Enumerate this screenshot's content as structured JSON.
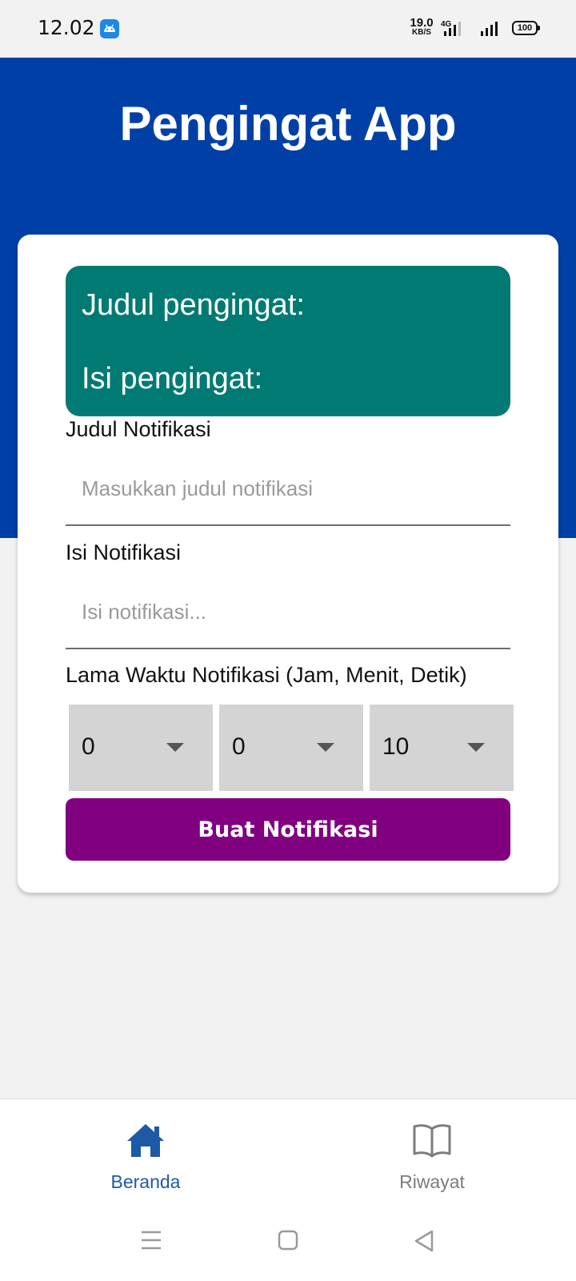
{
  "status_bar": {
    "time": "12.02",
    "net_speed_value": "19.0",
    "net_speed_unit": "KB/S",
    "network_type": "4G",
    "battery_level": "100",
    "icons": [
      "android-notification-icon",
      "signal-4g-icon",
      "signal-icon",
      "battery-icon"
    ]
  },
  "header": {
    "title": "Pengingat App",
    "background_color": "#0040a6"
  },
  "preview": {
    "title_label": "Judul pengingat:",
    "body_label": "Isi pengingat:",
    "background_color": "#007a72"
  },
  "form": {
    "title_field": {
      "label": "Judul Notifikasi",
      "placeholder": "Masukkan judul notifikasi",
      "value": ""
    },
    "body_field": {
      "label": "Isi Notifikasi",
      "placeholder": "Isi notifikasi...",
      "value": ""
    },
    "duration": {
      "label": "Lama Waktu Notifikasi (Jam, Menit, Detik)",
      "hours": "0",
      "minutes": "0",
      "seconds": "10"
    },
    "submit_label": "Buat Notifikasi",
    "submit_color": "#800080"
  },
  "bottom_nav": {
    "items": [
      {
        "label": "Beranda",
        "icon": "home-icon",
        "active": true
      },
      {
        "label": "Riwayat",
        "icon": "book-icon",
        "active": false
      }
    ],
    "active_color": "#1d5aa6"
  },
  "system_nav": {
    "icons": [
      "menu-icon",
      "home-square-icon",
      "back-triangle-icon"
    ]
  }
}
